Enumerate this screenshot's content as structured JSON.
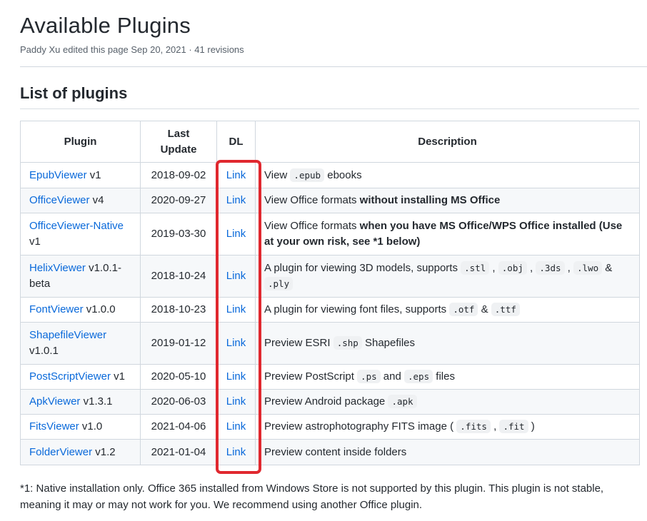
{
  "page": {
    "title": "Available Plugins",
    "meta": "Paddy Xu edited this page Sep 20, 2021 · 41 revisions",
    "section_title": "List of plugins"
  },
  "table": {
    "headers": {
      "plugin": "Plugin",
      "last_update_1": "Last",
      "last_update_2": "Update",
      "dl": "DL",
      "description": "Description"
    },
    "rows": [
      {
        "name": "EpubViewer",
        "version": " v1",
        "date": "2018-09-02",
        "dl": "Link",
        "desc": [
          {
            "t": "text",
            "v": "View "
          },
          {
            "t": "code",
            "v": ".epub"
          },
          {
            "t": "text",
            "v": " ebooks"
          }
        ]
      },
      {
        "name": "OfficeViewer",
        "version": " v4",
        "date": "2020-09-27",
        "dl": "Link",
        "desc": [
          {
            "t": "text",
            "v": "View Office formats "
          },
          {
            "t": "bold",
            "v": "without installing MS Office"
          }
        ]
      },
      {
        "name": "OfficeViewer-Native",
        "version": " v1",
        "date": "2019-03-30",
        "dl": "Link",
        "desc": [
          {
            "t": "text",
            "v": "View Office formats "
          },
          {
            "t": "bold",
            "v": "when you have MS Office/WPS Office installed (Use at your own risk, see *1 below)"
          }
        ]
      },
      {
        "name": "HelixViewer",
        "version": " v1.0.1-beta",
        "date": "2018-10-24",
        "dl": "Link",
        "desc": [
          {
            "t": "text",
            "v": "A plugin for viewing 3D models, supports "
          },
          {
            "t": "code",
            "v": ".stl"
          },
          {
            "t": "text",
            "v": " , "
          },
          {
            "t": "code",
            "v": ".obj"
          },
          {
            "t": "text",
            "v": " , "
          },
          {
            "t": "code",
            "v": ".3ds"
          },
          {
            "t": "text",
            "v": " , "
          },
          {
            "t": "code",
            "v": ".lwo"
          },
          {
            "t": "text",
            "v": " & "
          },
          {
            "t": "code",
            "v": ".ply"
          }
        ]
      },
      {
        "name": "FontViewer",
        "version": " v1.0.0",
        "date": "2018-10-23",
        "dl": "Link",
        "desc": [
          {
            "t": "text",
            "v": "A plugin for viewing font files, supports "
          },
          {
            "t": "code",
            "v": ".otf"
          },
          {
            "t": "text",
            "v": " & "
          },
          {
            "t": "code",
            "v": ".ttf"
          }
        ]
      },
      {
        "name": "ShapefileViewer",
        "version": " v1.0.1",
        "date": "2019-01-12",
        "dl": "Link",
        "desc": [
          {
            "t": "text",
            "v": "Preview ESRI "
          },
          {
            "t": "code",
            "v": ".shp"
          },
          {
            "t": "text",
            "v": " Shapefiles"
          }
        ]
      },
      {
        "name": "PostScriptViewer",
        "version": " v1",
        "date": "2020-05-10",
        "dl": "Link",
        "desc": [
          {
            "t": "text",
            "v": "Preview PostScript "
          },
          {
            "t": "code",
            "v": ".ps"
          },
          {
            "t": "text",
            "v": " and "
          },
          {
            "t": "code",
            "v": ".eps"
          },
          {
            "t": "text",
            "v": " files"
          }
        ]
      },
      {
        "name": "ApkViewer",
        "version": " v1.3.1",
        "date": "2020-06-03",
        "dl": "Link",
        "desc": [
          {
            "t": "text",
            "v": "Preview Android package "
          },
          {
            "t": "code",
            "v": ".apk"
          }
        ]
      },
      {
        "name": "FitsViewer",
        "version": " v1.0",
        "date": "2021-04-06",
        "dl": "Link",
        "desc": [
          {
            "t": "text",
            "v": "Preview astrophotography FITS image ( "
          },
          {
            "t": "code",
            "v": ".fits"
          },
          {
            "t": "text",
            "v": " , "
          },
          {
            "t": "code",
            "v": ".fit"
          },
          {
            "t": "text",
            "v": " )"
          }
        ]
      },
      {
        "name": "FolderViewer",
        "version": " v1.2",
        "date": "2021-01-04",
        "dl": "Link",
        "desc": [
          {
            "t": "text",
            "v": "Preview content inside folders"
          }
        ]
      }
    ]
  },
  "footnote": "*1: Native installation only. Office 365 installed from Windows Store is not supported by this plugin. This plugin is not stable, meaning it may or may not work for you. We recommend using another Office plugin.",
  "colors": {
    "link": "#0969da",
    "highlight": "#e0282f",
    "text": "#24292f",
    "muted": "#57606a"
  }
}
